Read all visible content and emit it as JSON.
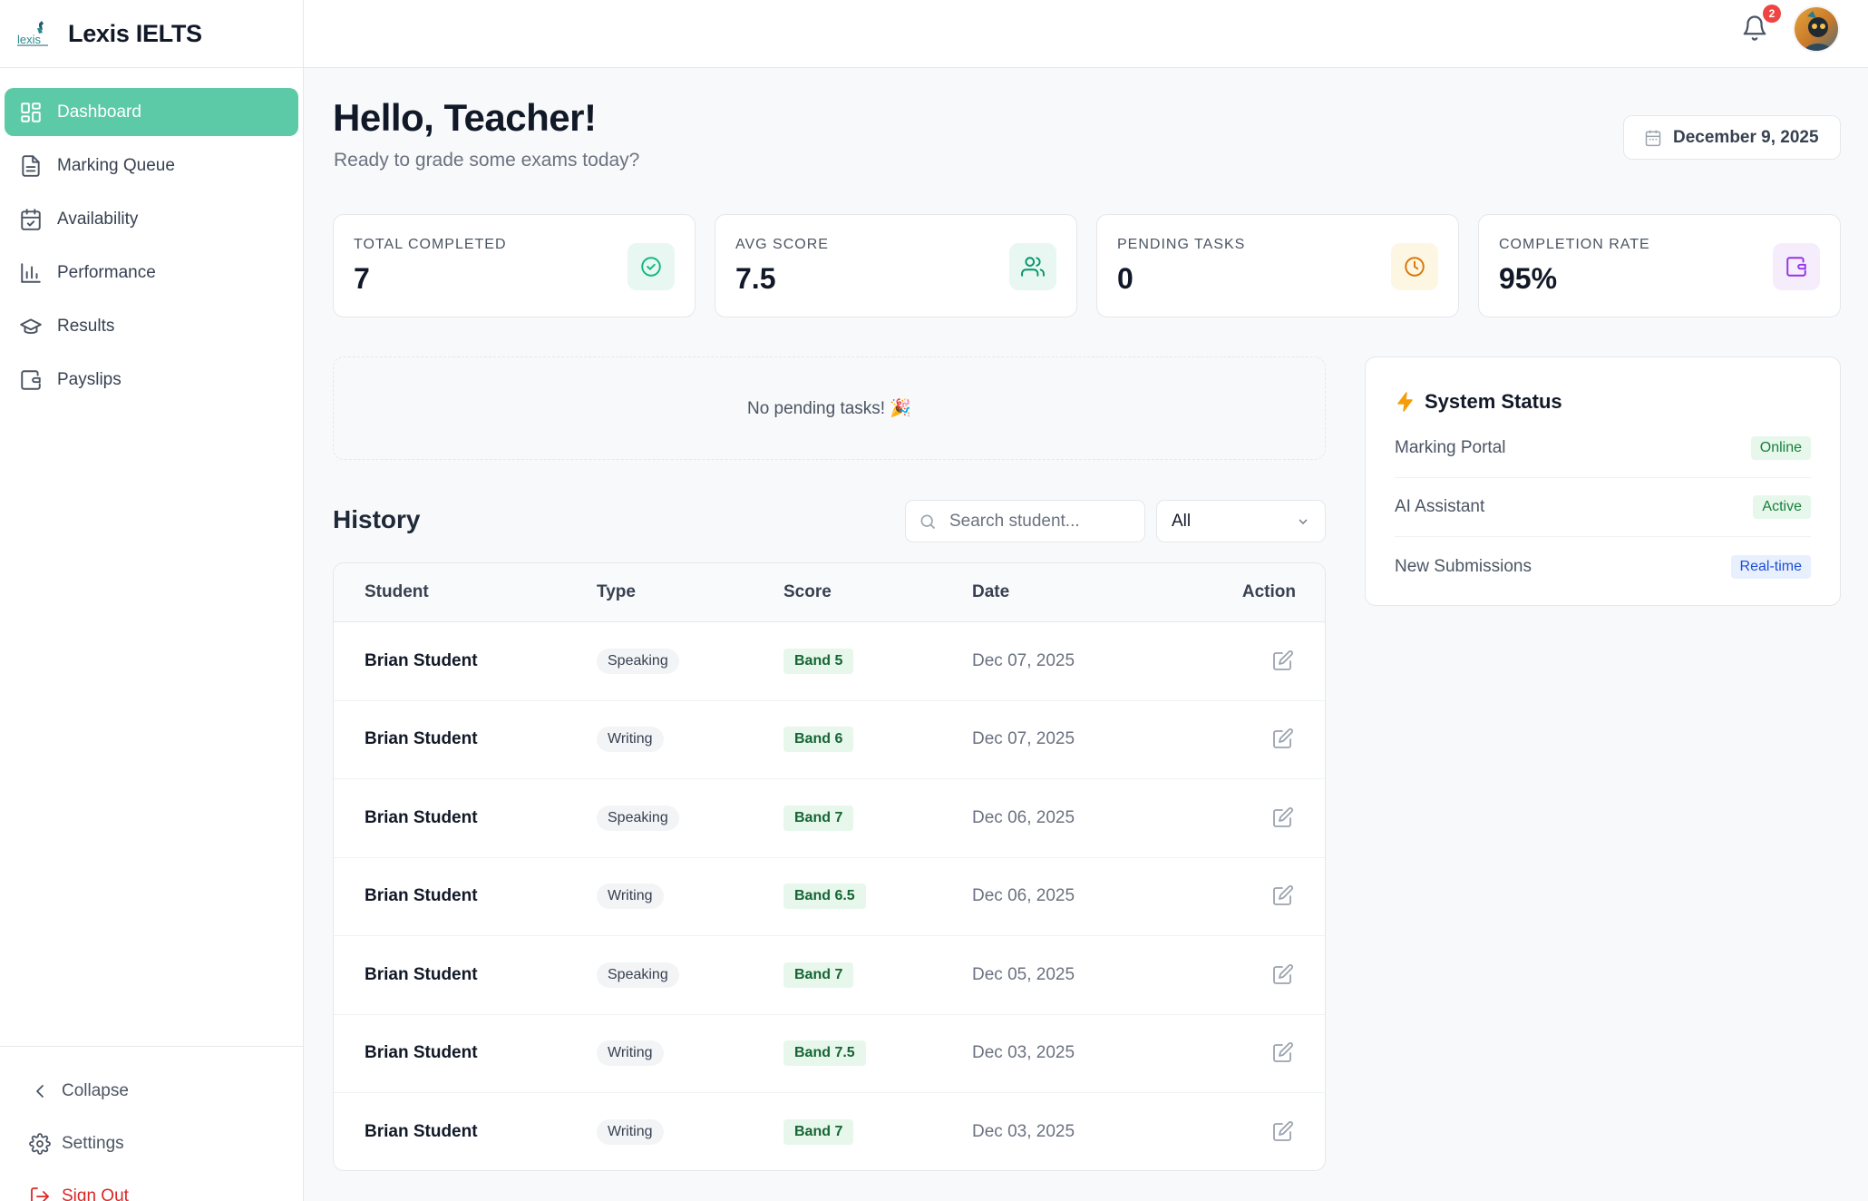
{
  "app": {
    "name": "Lexis IELTS",
    "logo_text": "lexis"
  },
  "sidebar": {
    "items": [
      {
        "label": "Dashboard",
        "icon": "dashboard-icon",
        "active": true
      },
      {
        "label": "Marking Queue",
        "icon": "document-icon",
        "active": false
      },
      {
        "label": "Availability",
        "icon": "calendar-check-icon",
        "active": false
      },
      {
        "label": "Performance",
        "icon": "bar-chart-icon",
        "active": false
      },
      {
        "label": "Results",
        "icon": "graduation-cap-icon",
        "active": false
      },
      {
        "label": "Payslips",
        "icon": "wallet-icon",
        "active": false
      }
    ],
    "bottom": {
      "collapse": "Collapse",
      "settings": "Settings",
      "signout": "Sign Out"
    }
  },
  "topbar": {
    "notification_count": "2"
  },
  "header": {
    "greeting": "Hello, Teacher!",
    "subtitle": "Ready to grade some exams today?",
    "date": "December 9, 2025"
  },
  "stats": [
    {
      "label": "TOTAL COMPLETED",
      "value": "7",
      "icon": "check-circle-icon",
      "color": "#10b981",
      "bg": "#e8f7f1"
    },
    {
      "label": "AVG SCORE",
      "value": "7.5",
      "icon": "users-icon",
      "color": "#059669",
      "bg": "#e8f7f1"
    },
    {
      "label": "PENDING TASKS",
      "value": "0",
      "icon": "clock-icon",
      "color": "#d97706",
      "bg": "#fdf6e3"
    },
    {
      "label": "COMPLETION RATE",
      "value": "95%",
      "icon": "wallet-icon",
      "color": "#9333ea",
      "bg": "#f5edfc"
    }
  ],
  "pending": {
    "empty_text": "No pending tasks! 🎉"
  },
  "history": {
    "title": "History",
    "search_placeholder": "Search student...",
    "filter_value": "All",
    "columns": {
      "student": "Student",
      "type": "Type",
      "score": "Score",
      "date": "Date",
      "action": "Action"
    },
    "rows": [
      {
        "student": "Brian Student",
        "type": "Speaking",
        "score": "Band 5",
        "date": "Dec 07, 2025"
      },
      {
        "student": "Brian Student",
        "type": "Writing",
        "score": "Band 6",
        "date": "Dec 07, 2025"
      },
      {
        "student": "Brian Student",
        "type": "Speaking",
        "score": "Band 7",
        "date": "Dec 06, 2025"
      },
      {
        "student": "Brian Student",
        "type": "Writing",
        "score": "Band 6.5",
        "date": "Dec 06, 2025"
      },
      {
        "student": "Brian Student",
        "type": "Speaking",
        "score": "Band 7",
        "date": "Dec 05, 2025"
      },
      {
        "student": "Brian Student",
        "type": "Writing",
        "score": "Band 7.5",
        "date": "Dec 03, 2025"
      },
      {
        "student": "Brian Student",
        "type": "Writing",
        "score": "Band 7",
        "date": "Dec 03, 2025"
      }
    ]
  },
  "system_status": {
    "title": "System Status",
    "items": [
      {
        "label": "Marking Portal",
        "status": "Online",
        "tone": "green"
      },
      {
        "label": "AI Assistant",
        "status": "Active",
        "tone": "green"
      },
      {
        "label": "New Submissions",
        "status": "Real-time",
        "tone": "blue"
      }
    ]
  },
  "colors": {
    "accent": "#5cc9a7",
    "danger": "#dc2626"
  }
}
